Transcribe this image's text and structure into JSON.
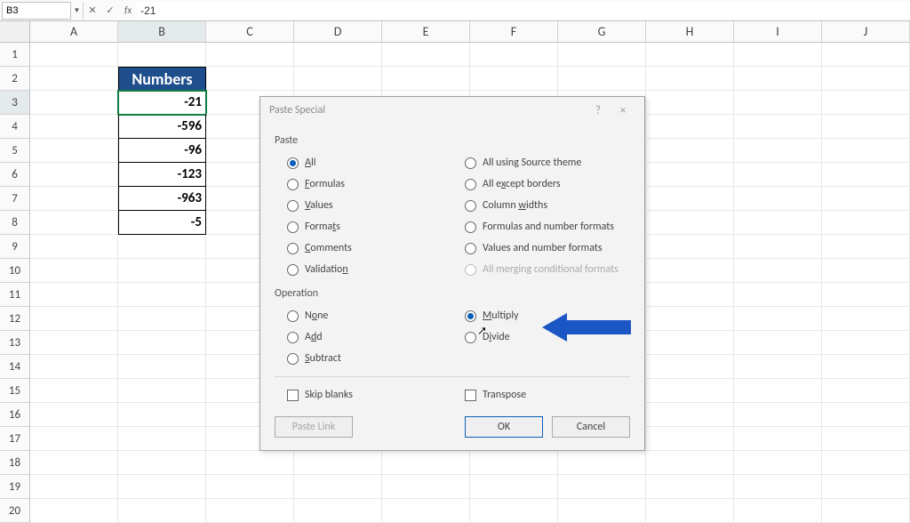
{
  "formula_bar": {
    "name_box": "B3",
    "fx": "fx",
    "value": "-21"
  },
  "columns": [
    "A",
    "B",
    "C",
    "D",
    "E",
    "F",
    "G",
    "H",
    "I",
    "J"
  ],
  "rows": [
    "1",
    "2",
    "3",
    "4",
    "5",
    "6",
    "7",
    "8",
    "9",
    "10",
    "11",
    "12",
    "13",
    "14",
    "15",
    "16",
    "17",
    "18",
    "19",
    "20"
  ],
  "data": {
    "header": "Numbers",
    "values": [
      "-21",
      "-596",
      "-96",
      "-123",
      "-963",
      "-5"
    ]
  },
  "active_cell": "B3",
  "dialog": {
    "title": "Paste Special",
    "help": "?",
    "close": "×",
    "paste_label": "Paste",
    "operation_label": "Operation",
    "paste_left": [
      {
        "label": "All",
        "accel": "A",
        "selected": true
      },
      {
        "label": "Formulas",
        "accel": "F",
        "selected": false
      },
      {
        "label": "Values",
        "accel": "V",
        "selected": false
      },
      {
        "label": "Formats",
        "accel": "t",
        "selected": false
      },
      {
        "label": "Comments",
        "accel": "C",
        "selected": false
      },
      {
        "label": "Validation",
        "accel": "n",
        "selected": false
      }
    ],
    "paste_right": [
      {
        "label": "All using Source theme",
        "accel": "",
        "selected": false
      },
      {
        "label": "All except borders",
        "accel": "x",
        "selected": false
      },
      {
        "label": "Column widths",
        "accel": "w",
        "selected": false
      },
      {
        "label": "Formulas and number formats",
        "accel": "",
        "selected": false
      },
      {
        "label": "Values and number formats",
        "accel": "",
        "selected": false
      },
      {
        "label": "All merging conditional formats",
        "accel": "",
        "selected": false,
        "disabled": true
      }
    ],
    "op_left": [
      {
        "label": "None",
        "accel": "o",
        "selected": false
      },
      {
        "label": "Add",
        "accel": "d",
        "selected": false
      },
      {
        "label": "Subtract",
        "accel": "S",
        "selected": false
      }
    ],
    "op_right": [
      {
        "label": "Multiply",
        "accel": "M",
        "selected": true
      },
      {
        "label": "Divide",
        "accel": "i",
        "selected": false
      }
    ],
    "skip_blanks": "Skip blanks",
    "transpose": "Transpose",
    "paste_link": "Paste Link",
    "ok": "OK",
    "cancel": "Cancel"
  }
}
